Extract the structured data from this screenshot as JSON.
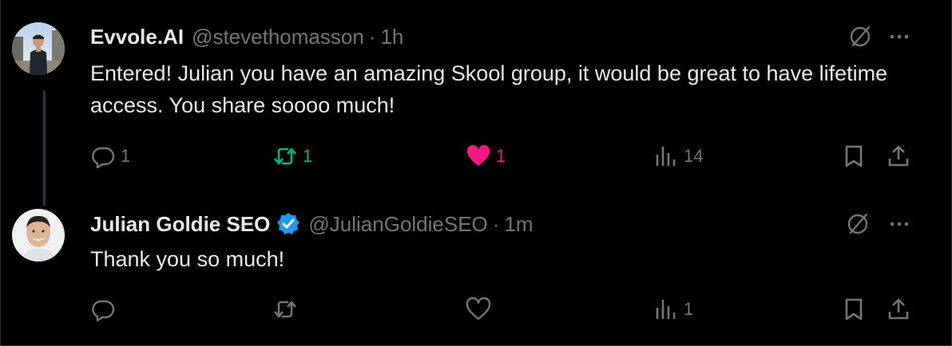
{
  "colors": {
    "background": "#000000",
    "text_primary": "#e7e9ea",
    "text_secondary": "#71767b",
    "retweet_active": "#00ba7c",
    "like_active": "#f91880",
    "verified_badge": "#1d9bf0",
    "thread_line": "#333639"
  },
  "tweets": [
    {
      "display_name": "Evvole.AI",
      "handle": "@stevethomasson",
      "separator": "·",
      "time": "1h",
      "verified": false,
      "avatar_icon": "user-avatar-photo",
      "text": "Entered! Julian you have an amazing Skool group, it would be great to have lifetime access. You share soooo much!",
      "replies": "1",
      "retweets": "1",
      "retweeted": true,
      "likes": "1",
      "liked": true,
      "views": "14"
    },
    {
      "display_name": "Julian Goldie SEO",
      "handle": "@JulianGoldieSEO",
      "separator": "·",
      "time": "1m",
      "verified": true,
      "avatar_icon": "user-avatar-photo",
      "text": "Thank you so much!",
      "replies": "",
      "retweets": "",
      "retweeted": false,
      "likes": "",
      "liked": false,
      "views": "1"
    }
  ],
  "icons": {
    "grok": "grok-icon",
    "more": "more-options-icon",
    "reply": "reply-icon",
    "retweet": "retweet-icon",
    "like": "heart-icon",
    "views": "views-chart-icon",
    "bookmark": "bookmark-icon",
    "share": "share-icon",
    "verified": "verified-badge-icon"
  }
}
